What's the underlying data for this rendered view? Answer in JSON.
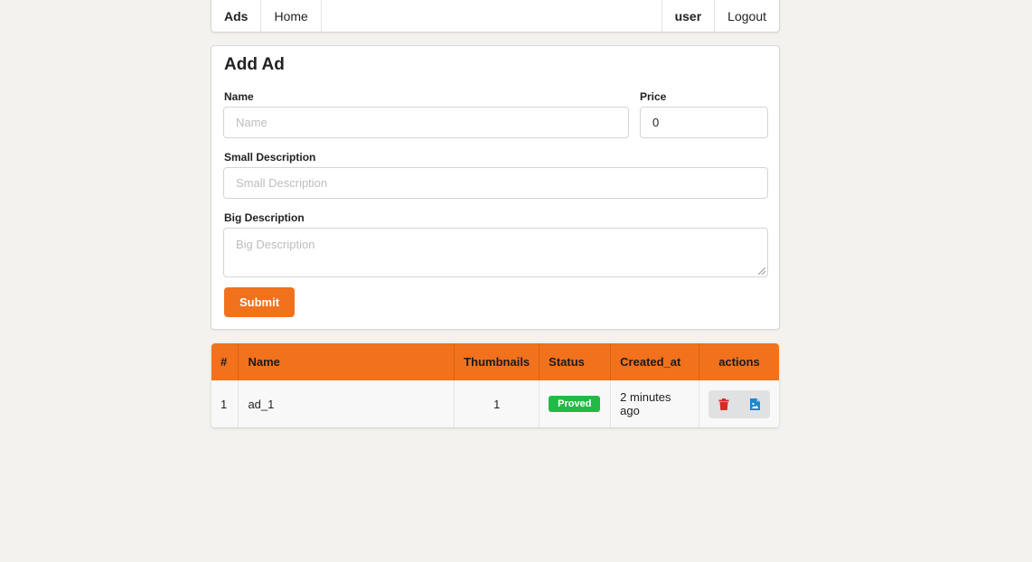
{
  "nav": {
    "brand": "Ads",
    "home": "Home",
    "user": "user",
    "logout": "Logout"
  },
  "form": {
    "title": "Add Ad",
    "name_label": "Name",
    "name_placeholder": "Name",
    "price_label": "Price",
    "price_value": "0",
    "small_desc_label": "Small Description",
    "small_desc_placeholder": "Small Description",
    "big_desc_label": "Big Description",
    "big_desc_placeholder": "Big Description",
    "submit_label": "Submit"
  },
  "table": {
    "headers": [
      "#",
      "Name",
      "Thumbnails",
      "Status",
      "Created_at",
      "actions"
    ],
    "rows": [
      {
        "index": "1",
        "name": "ad_1",
        "thumbnails": "1",
        "status": "Proved",
        "created_at": "2 minutes ago"
      }
    ]
  },
  "colors": {
    "accent": "#f2711c",
    "status_green": "#21ba45",
    "delete_red": "#db2828",
    "image_blue": "#2185d0"
  },
  "icons": {
    "delete": "trash-icon",
    "image": "file-image-icon"
  }
}
